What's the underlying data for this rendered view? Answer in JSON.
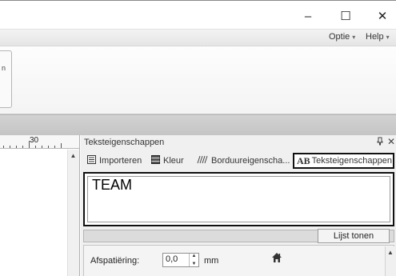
{
  "window": {
    "minimize_glyph": "–",
    "maximize_glyph": "☐",
    "close_glyph": "✕"
  },
  "menu": {
    "options_label": "Optie",
    "help_label": "Help",
    "caret": "▾"
  },
  "ribbon": {
    "group_fragment": "n"
  },
  "canvas": {
    "ruler_label": "30",
    "scroll_up": "▲"
  },
  "panel": {
    "title": "Teksteigenschappen",
    "pin_glyph": "ᵖ",
    "close_glyph": "✕",
    "tabs": [
      {
        "label": "Importeren",
        "icon": "import-icon"
      },
      {
        "label": "Kleur",
        "icon": "color-icon"
      },
      {
        "label": "Borduureigenscha...",
        "icon": "embroidery-props-icon"
      },
      {
        "label": "Teksteigenschappen",
        "icon": "text-props-icon",
        "icon_text": "AB",
        "active": true
      }
    ],
    "text_value": "TEAM",
    "list_tones_button": "Lijst tonen",
    "spacing": {
      "label": "Afspatiëring:",
      "value": "0,0",
      "unit": "mm"
    },
    "grid_scroll_up": "▲"
  },
  "colors": {
    "highlight_border": "#111111",
    "panel_bg": "#f0f0f0",
    "dock_bar": "#c8c8c8"
  }
}
